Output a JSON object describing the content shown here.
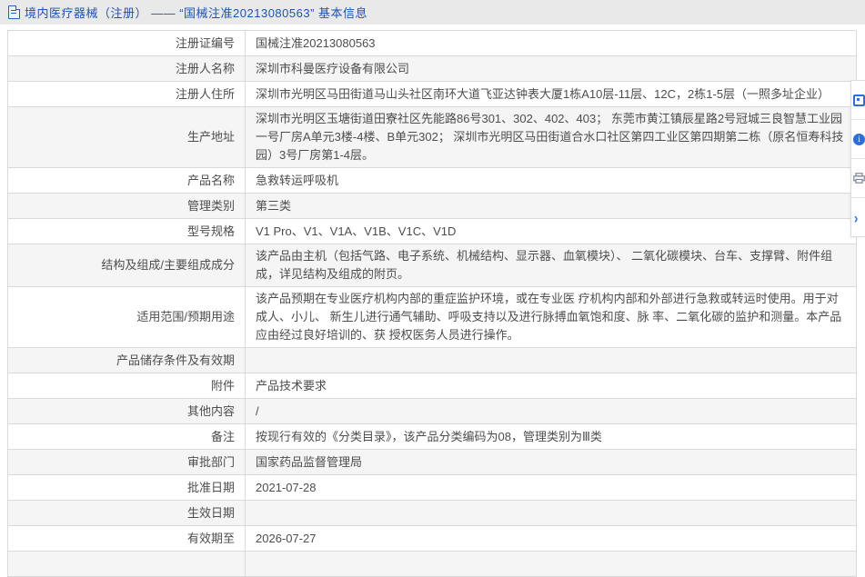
{
  "header": {
    "title": "境内医疗器械（注册） —— “国械注准20213080563” 基本信息"
  },
  "colors": {
    "title_blue": "#1d53b0",
    "panel_icon_blue": "#2e6fd6",
    "row_alt_gray": "#f5f5f5",
    "topbar_gray": "#e9e9e9",
    "border_gray": "#d9d9d9"
  },
  "table": {
    "rows": [
      {
        "label": "注册证编号",
        "value": "国械注准20213080563"
      },
      {
        "label": "注册人名称",
        "value": "深圳市科曼医疗设备有限公司"
      },
      {
        "label": "注册人住所",
        "value": "深圳市光明区马田街道马山头社区南环大道飞亚达钟表大厦1栋A10层-11层、12C，2栋1-5层（一照多址企业）"
      },
      {
        "label": "生产地址",
        "value": "深圳市光明区玉塘街道田寮社区先能路86号301、302、402、403； 东莞市黄江镇辰星路2号冠城三良智慧工业园一号厂房A单元3楼-4楼、B单元302； 深圳市光明区马田街道合水口社区第四工业区第四期第二栋（原名恒寿科技园）3号厂房第1-4层。"
      },
      {
        "label": "产品名称",
        "value": "急救转运呼吸机"
      },
      {
        "label": "管理类别",
        "value": "第三类"
      },
      {
        "label": "型号规格",
        "value": "V1 Pro、V1、V1A、V1B、V1C、V1D"
      },
      {
        "label": "结构及组成/主要组成成分",
        "value": "该产品由主机（包括气路、电子系统、机械结构、显示器、血氧模块）、 二氧化碳模块、台车、支撑臂、附件组成，详见结构及组成的附页。"
      },
      {
        "label": "适用范围/预期用途",
        "value": "该产品预期在专业医疗机构内部的重症监护环境，或在专业医 疗机构内部和外部进行急救或转运时使用。用于对成人、小儿、 新生儿进行通气辅助、呼吸支持以及进行脉搏血氧饱和度、脉 率、二氧化碳的监护和测量。本产品应由经过良好培训的、获 授权医务人员进行操作。"
      },
      {
        "label": "产品储存条件及有效期",
        "value": ""
      },
      {
        "label": "附件",
        "value": "产品技术要求"
      },
      {
        "label": "其他内容",
        "value": "/"
      },
      {
        "label": "备注",
        "value": "按现行有效的《分类目录》，该产品分类编码为08，管理类别为Ⅲ类"
      },
      {
        "label": "审批部门",
        "value": "国家药品监督管理局"
      },
      {
        "label": "批准日期",
        "value": "2021-07-28"
      },
      {
        "label": "生效日期",
        "value": ""
      },
      {
        "label": "有效期至",
        "value": "2026-07-27"
      },
      {
        "label": "",
        "value": ""
      }
    ]
  },
  "side_panel": {
    "icons": [
      "feedback-icon",
      "service-icon",
      "printer-icon",
      "chevron-right-icon"
    ],
    "service_glyph": "i",
    "chevron_glyph": "›"
  }
}
